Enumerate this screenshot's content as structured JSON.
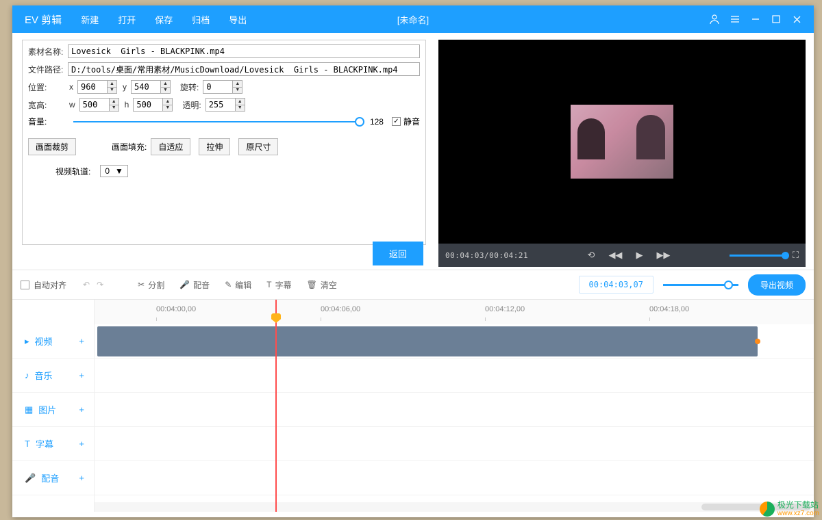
{
  "app": {
    "title": "EV 剪辑",
    "doc_name": "[未命名]"
  },
  "menu": {
    "new": "新建",
    "open": "打开",
    "save": "保存",
    "archive": "归档",
    "export": "导出"
  },
  "props": {
    "name_label": "素材名称:",
    "name_value": "Lovesick  Girls - BLACKPINK.mp4",
    "path_label": "文件路径:",
    "path_value": "D:/tools/桌面/常用素材/MusicDownload/Lovesick  Girls - BLACKPINK.mp4",
    "pos_label": "位置:",
    "x_label": "x",
    "x_value": "960",
    "y_label": "y",
    "y_value": "540",
    "rot_label": "旋转:",
    "rot_value": "0",
    "size_label": "宽高:",
    "w_label": "w",
    "w_value": "500",
    "h_label": "h",
    "h_value": "500",
    "opacity_label": "透明:",
    "opacity_value": "255",
    "volume_label": "音量:",
    "volume_value": "128",
    "mute_label": "静音",
    "crop_btn": "画面裁剪",
    "fill_label": "画面填充:",
    "fill_fit": "自适应",
    "fill_stretch": "拉伸",
    "fill_orig": "原尺寸",
    "track_label": "视频轨道:",
    "track_value": "0",
    "return_btn": "返回"
  },
  "preview": {
    "time": "00:04:03/00:04:21"
  },
  "toolbar": {
    "auto_align": "自动对齐",
    "split": "分割",
    "dub": "配音",
    "edit": "编辑",
    "subtitle": "字幕",
    "clear": "清空",
    "time": "00:04:03,07",
    "export_btn": "导出视频"
  },
  "ruler": {
    "t0": "00:04:00,00",
    "t1": "00:04:06,00",
    "t2": "00:04:12,00",
    "t3": "00:04:18,00"
  },
  "tracks": {
    "video": "视频",
    "music": "音乐",
    "image": "图片",
    "subtitle": "字幕",
    "dub": "配音"
  },
  "watermark": {
    "name": "极光下载站",
    "url": "www.xz7.com"
  }
}
